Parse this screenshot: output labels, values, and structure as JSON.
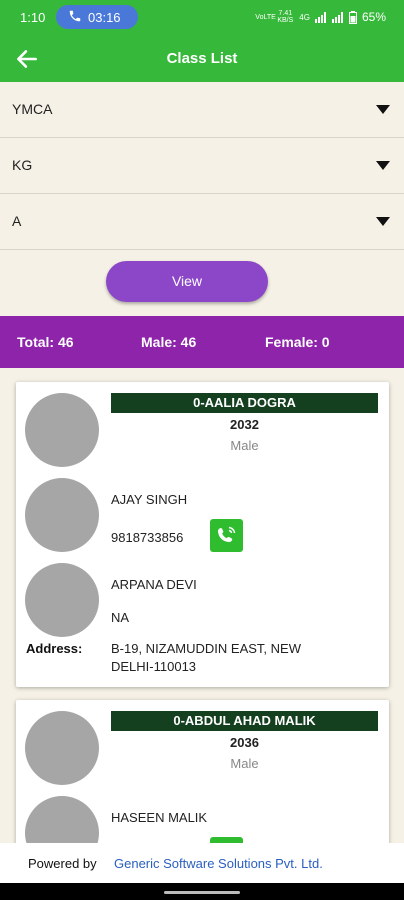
{
  "status_bar": {
    "time": "1:10",
    "call_duration": "03:16",
    "net_a": "VoLTE",
    "net_b": "7.41 KB/S",
    "net_c": "4G",
    "battery": "65%"
  },
  "app_bar": {
    "title": "Class List"
  },
  "filters": {
    "school": "YMCA",
    "class": "KG",
    "section": "A"
  },
  "view_button": "View",
  "summary": {
    "total": "Total: 46",
    "male": "Male: 46",
    "female": "Female: 0"
  },
  "students": [
    {
      "name": "0-AALIA DOGRA",
      "roll": "2032",
      "gender": "Male",
      "father_name": "AJAY SINGH",
      "father_phone": "9818733856",
      "mother_name": "ARPANA DEVI",
      "mother_phone": "NA",
      "address_label": "Address:",
      "address": "B-19, NIZAMUDDIN EAST, NEW DELHI-110013"
    },
    {
      "name": "0-ABDUL AHAD MALIK",
      "roll": "2036",
      "gender": "Male",
      "father_name": "HASEEN MALIK"
    }
  ],
  "footer": {
    "powered_by": "Powered by",
    "company": "Generic Software Solutions Pvt. Ltd."
  },
  "colors": {
    "primary_green": "#36b83a",
    "accent_purple": "#8e24aa",
    "name_bar": "#15401f"
  }
}
